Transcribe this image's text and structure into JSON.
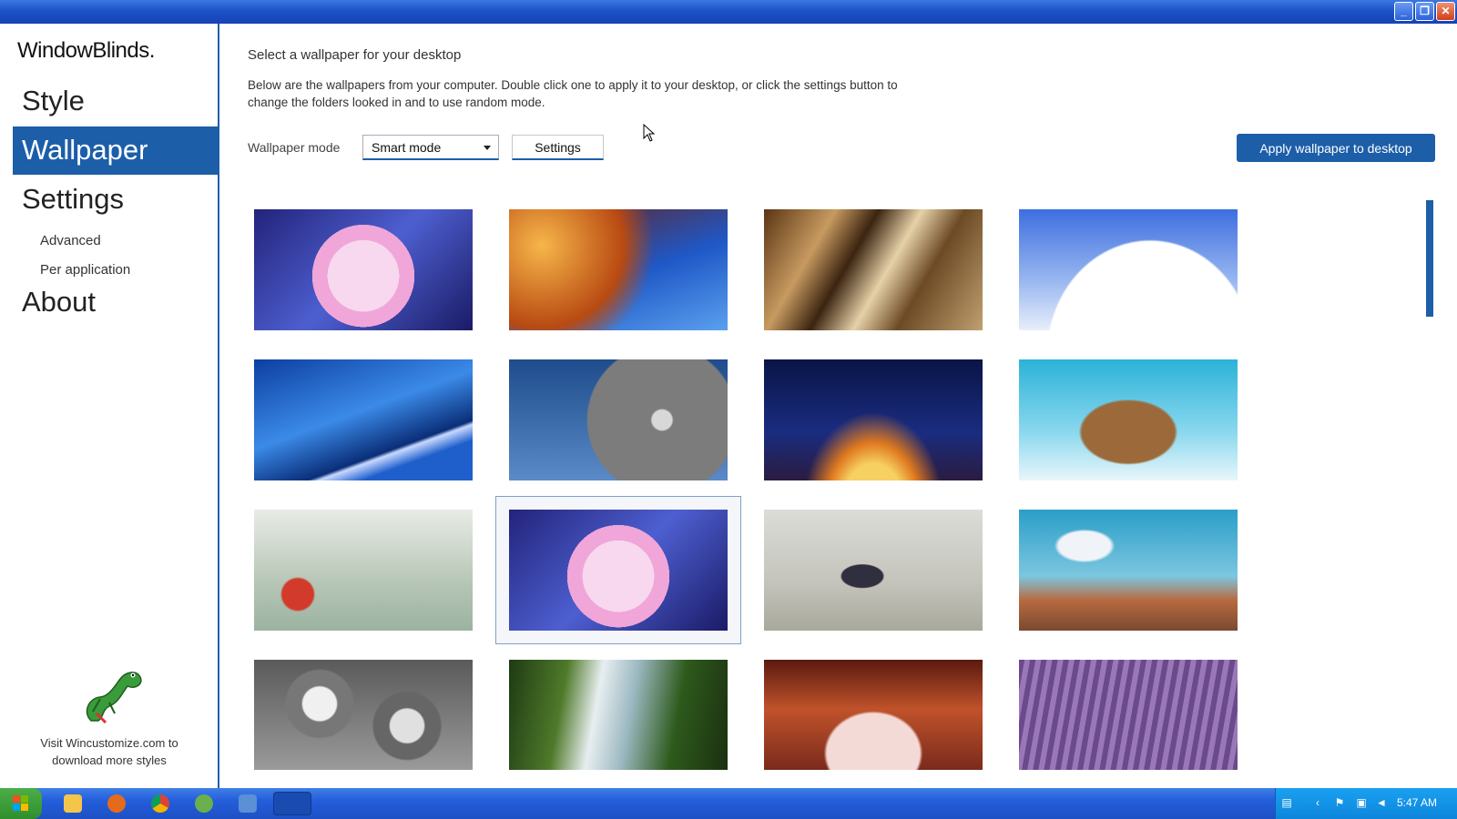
{
  "app": {
    "logo": "WindowBlinds."
  },
  "nav": {
    "style": "Style",
    "wallpaper": "Wallpaper",
    "settings": "Settings",
    "advanced": "Advanced",
    "per_application": "Per application",
    "about": "About"
  },
  "footer": {
    "visit_text": "Visit Wincustomize.com to download more styles"
  },
  "main": {
    "title": "Select a wallpaper for your desktop",
    "description": "Below are the wallpapers from your computer.  Double click one to apply it to your desktop, or click the settings button to change the folders looked in and to use random mode.",
    "mode_label": "Wallpaper mode",
    "mode_value": "Smart mode",
    "settings_button": "Settings",
    "apply_button": "Apply wallpaper to desktop"
  },
  "wallpapers": [
    "cartoon-astronaut",
    "space-needle",
    "abstract-bronze",
    "white-curved-building",
    "blue-architecture",
    "dotted-dome",
    "arch-sunset",
    "flying-turtle-city",
    "fantasy-creatures",
    "cartoon-astronaut-selected",
    "robot-creatures",
    "flying-figure-village",
    "grey-faces",
    "waterfall",
    "rock-arch-canyon",
    "lavender-field"
  ],
  "selected_wallpaper_index": 9,
  "taskbar": {
    "clock": "5:47 AM"
  },
  "colors": {
    "accent": "#1c5ea8",
    "titlebar": "#1d52c8"
  }
}
